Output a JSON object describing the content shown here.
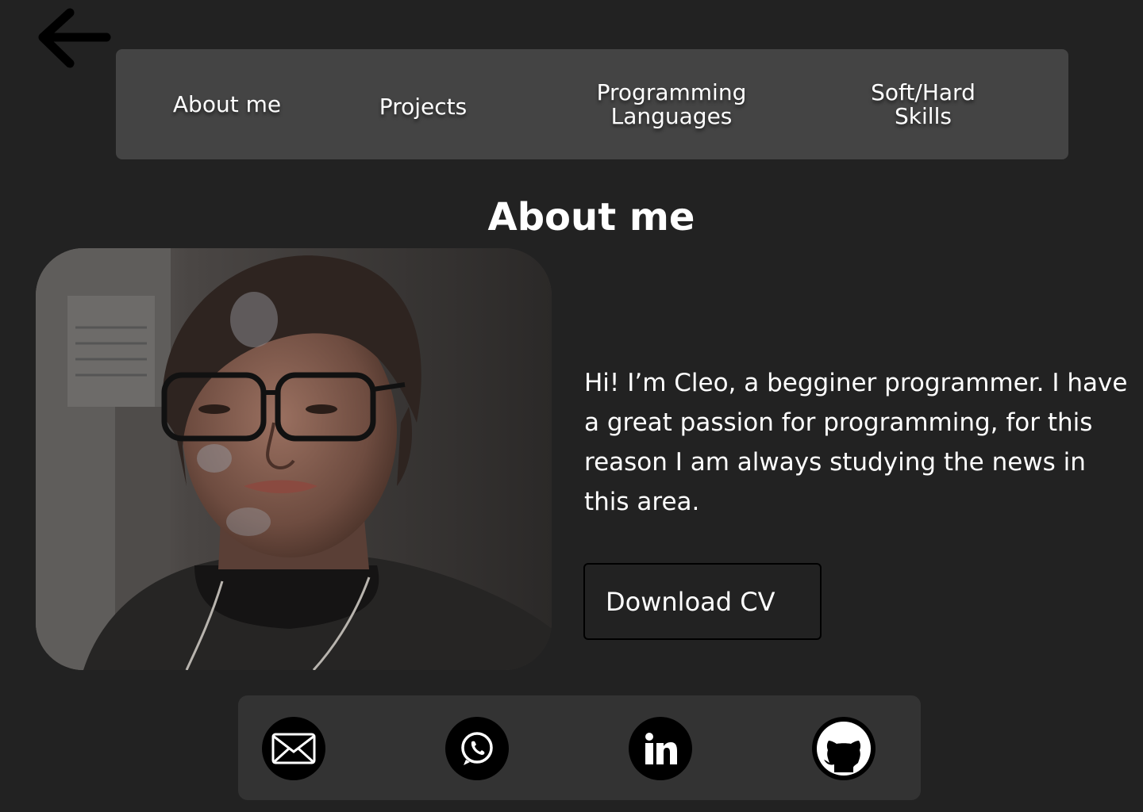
{
  "nav": {
    "back_icon": "arrow-left-icon",
    "items": [
      {
        "label": "About me"
      },
      {
        "label": "Projects"
      },
      {
        "label_line1": "Programming",
        "label_line2": "Languages"
      },
      {
        "label_line1": "Soft/Hard",
        "label_line2": "Skills"
      }
    ]
  },
  "about": {
    "title": "About me",
    "bio": "Hi! I’m Cleo, a begginer programmer.  I have a great passion for programming, for this reason I am always studying the news in this area.",
    "download_label": "Download CV"
  },
  "social": [
    {
      "icon": "mail-icon"
    },
    {
      "icon": "whatsapp-icon"
    },
    {
      "icon": "linkedin-icon"
    },
    {
      "icon": "github-icon"
    }
  ],
  "colors": {
    "background": "#222222",
    "nav_bar": "#444444",
    "social_bar": "#333333",
    "text": "#ffffff",
    "icon": "#000000"
  }
}
